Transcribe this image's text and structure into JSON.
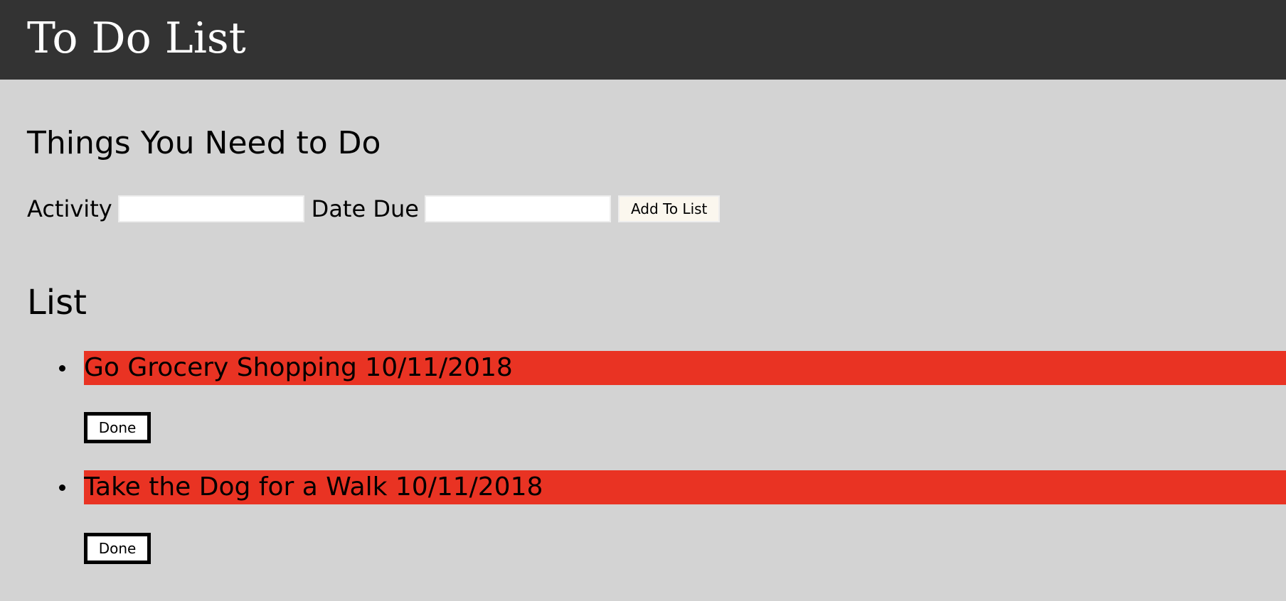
{
  "header": {
    "title": "To Do List"
  },
  "form": {
    "heading": "Things You Need to Do",
    "activity_label": "Activity",
    "activity_value": "",
    "date_label": "Date Due",
    "date_value": "",
    "add_button_label": "Add To List"
  },
  "list": {
    "heading": "List",
    "items": [
      {
        "text": "Go Grocery Shopping 10/11/2018",
        "button_label": "Done"
      },
      {
        "text": "Take the Dog for a Walk 10/11/2018",
        "button_label": "Done"
      }
    ]
  },
  "colors": {
    "header_bg": "#333333",
    "page_bg": "#d3d3d3",
    "item_highlight": "#e93323"
  }
}
